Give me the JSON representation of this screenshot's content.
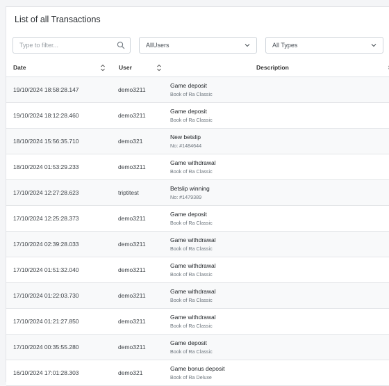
{
  "title": "List of all Transactions",
  "filters": {
    "search_placeholder": "Type to filter...",
    "users_value": "AllUsers",
    "types_value": "All Types"
  },
  "table": {
    "headers": {
      "date": "Date",
      "user": "User",
      "description": "Description",
      "extra": "S"
    },
    "rows": [
      {
        "date": "19/10/2024 18:58:28.147",
        "user": "demo3211",
        "title": "Game deposit",
        "sub": "Book of Ra Classic"
      },
      {
        "date": "19/10/2024 18:12:28.460",
        "user": "demo3211",
        "title": "Game deposit",
        "sub": "Book of Ra Classic"
      },
      {
        "date": "18/10/2024 15:56:35.710",
        "user": "demo321",
        "title": "New betslip",
        "sub": "No: #1484644"
      },
      {
        "date": "18/10/2024 01:53:29.233",
        "user": "demo3211",
        "title": "Game withdrawal",
        "sub": "Book of Ra Classic"
      },
      {
        "date": "17/10/2024 12:27:28.623",
        "user": "triptitest",
        "title": "Betslip winning",
        "sub": "No: #1479389"
      },
      {
        "date": "17/10/2024 12:25:28.373",
        "user": "demo3211",
        "title": "Game deposit",
        "sub": "Book of Ra Classic"
      },
      {
        "date": "17/10/2024 02:39:28.033",
        "user": "demo3211",
        "title": "Game withdrawal",
        "sub": "Book of Ra Classic"
      },
      {
        "date": "17/10/2024 01:51:32.040",
        "user": "demo3211",
        "title": "Game withdrawal",
        "sub": "Book of Ra Classic"
      },
      {
        "date": "17/10/2024 01:22:03.730",
        "user": "demo3211",
        "title": "Game withdrawal",
        "sub": "Book of Ra Classic"
      },
      {
        "date": "17/10/2024 01:21:27.850",
        "user": "demo3211",
        "title": "Game withdrawal",
        "sub": "Book of Ra Classic"
      },
      {
        "date": "17/10/2024 00:35:55.280",
        "user": "demo3211",
        "title": "Game deposit",
        "sub": "Book of Ra Classic"
      },
      {
        "date": "16/10/2024 17:01:28.303",
        "user": "demo321",
        "title": "Game bonus deposit",
        "sub": "Book of Ra Deluxe"
      }
    ]
  }
}
